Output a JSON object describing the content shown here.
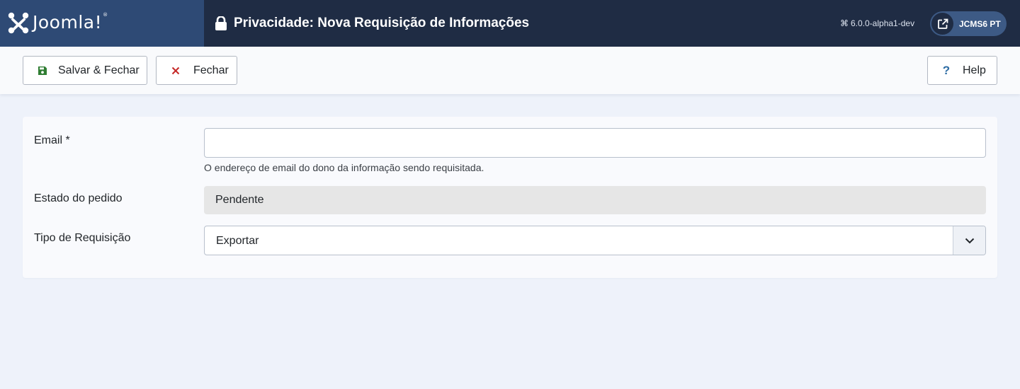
{
  "header": {
    "brand": "Joomla!",
    "title": "Privacidade: Nova Requisição de Informações",
    "version": "6.0.0-alpha1-dev",
    "site_label": "JCMS6 PT"
  },
  "toolbar": {
    "save_close_label": "Salvar & Fechar",
    "close_label": "Fechar",
    "help_label": "Help"
  },
  "form": {
    "email_label": "Email *",
    "email_value": "",
    "email_help": "O endereço de email do dono da informação sendo requisitada.",
    "status_label": "Estado do pedido",
    "status_value": "Pendente",
    "type_label": "Tipo de Requisição",
    "type_value": "Exportar"
  },
  "icons": {
    "brand": "joomla-logo-icon",
    "title": "lock-icon",
    "version": "joomla-small-icon",
    "site": "external-link-icon",
    "save": "floppy-disk-icon",
    "close": "close-x-icon",
    "help": "question-icon",
    "select": "chevron-down-icon"
  },
  "colors": {
    "header_bg": "#1f2c44",
    "logo_bg": "#2e4a75",
    "save_icon": "#2f7d32",
    "close_icon": "#c52827",
    "help_icon": "#2e6da4"
  }
}
